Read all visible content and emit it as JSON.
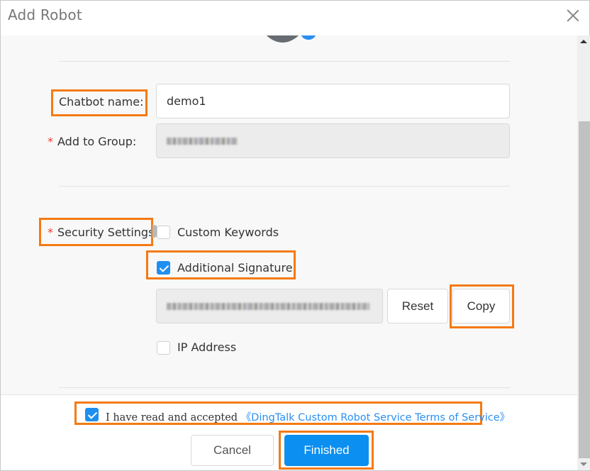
{
  "dialog": {
    "title": "Add Robot",
    "close_icon": "close-icon"
  },
  "form": {
    "chatbot_name": {
      "label": "Chatbot name:",
      "value": "demo1"
    },
    "add_to_group": {
      "required_mark": "*",
      "label": "Add to Group:",
      "value": "(blurred group name)"
    },
    "security_settings": {
      "required_mark": "*",
      "label": "Security Settings",
      "help_icon": "question-circle-icon",
      "options": [
        {
          "label": "Custom Keywords",
          "checked": false
        },
        {
          "label": "Additional Signature",
          "checked": true
        },
        {
          "label": "IP Address",
          "checked": false
        }
      ],
      "signature": {
        "value": "(blurred secret key)",
        "reset_label": "Reset",
        "copy_label": "Copy"
      }
    }
  },
  "footer": {
    "agreement": {
      "checked": true,
      "text": "I have read and accepted ",
      "link_text": "《DingTalk Custom Robot Service Terms of Service》"
    },
    "cancel_label": "Cancel",
    "finished_label": "Finished"
  },
  "colors": {
    "primary": "#0b8ff0",
    "highlight": "#f57a12",
    "required": "#f04134",
    "link": "#2a8ff0"
  }
}
